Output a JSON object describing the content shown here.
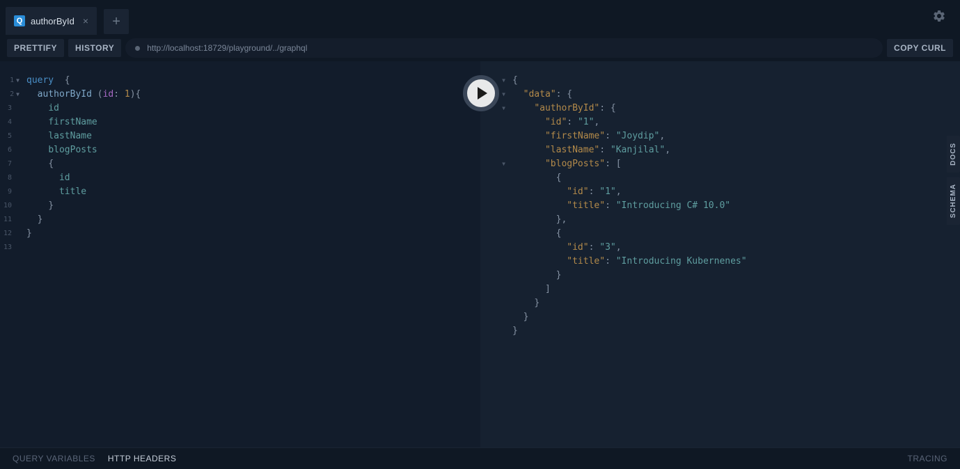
{
  "tab": {
    "icon": "Q",
    "label": "authorById"
  },
  "toolbar": {
    "prettify": "PRETTIFY",
    "history": "HISTORY",
    "copy_curl": "COPY CURL",
    "url": "http://localhost:18729/playground/../graphql"
  },
  "side": {
    "docs": "DOCS",
    "schema": "SCHEMA"
  },
  "bottom": {
    "query_vars": "QUERY VARIABLES",
    "http_headers": "HTTP HEADERS",
    "tracing": "TRACING"
  },
  "query": {
    "l1_kw": "query",
    "l1_b": "{",
    "l2_fn": "authorById",
    "l2_p1": "(",
    "l2_arg": "id",
    "l2_colon": ":",
    "l2_num": "1",
    "l2_p2": "){",
    "l3": "id",
    "l4": "firstName",
    "l5": "lastName",
    "l6": "blogPosts",
    "l7": "{",
    "l8": "id",
    "l9": "title",
    "l10": "}",
    "l11": "}",
    "l12": "}"
  },
  "result": {
    "r1": "{",
    "r2_k": "\"data\"",
    "r2_p": ": {",
    "r3_k": "\"authorById\"",
    "r3_p": ": {",
    "r4_k": "\"id\"",
    "r4_c": ": ",
    "r4_v": "\"1\"",
    "r4_e": ",",
    "r5_k": "\"firstName\"",
    "r5_c": ": ",
    "r5_v": "\"Joydip\"",
    "r5_e": ",",
    "r6_k": "\"lastName\"",
    "r6_c": ": ",
    "r6_v": "\"Kanjilal\"",
    "r6_e": ",",
    "r7_k": "\"blogPosts\"",
    "r7_p": ": [",
    "r8": "{",
    "r9_k": "\"id\"",
    "r9_c": ": ",
    "r9_v": "\"1\"",
    "r9_e": ",",
    "r10_k": "\"title\"",
    "r10_c": ": ",
    "r10_v": "\"Introducing C# 10.0\"",
    "r11": "},",
    "r12": "{",
    "r13_k": "\"id\"",
    "r13_c": ": ",
    "r13_v": "\"3\"",
    "r13_e": ",",
    "r14_k": "\"title\"",
    "r14_c": ": ",
    "r14_v": "\"Introducing Kubernenes\"",
    "r15": "}",
    "r16": "]",
    "r17": "}",
    "r18": "}",
    "r19": "}"
  }
}
